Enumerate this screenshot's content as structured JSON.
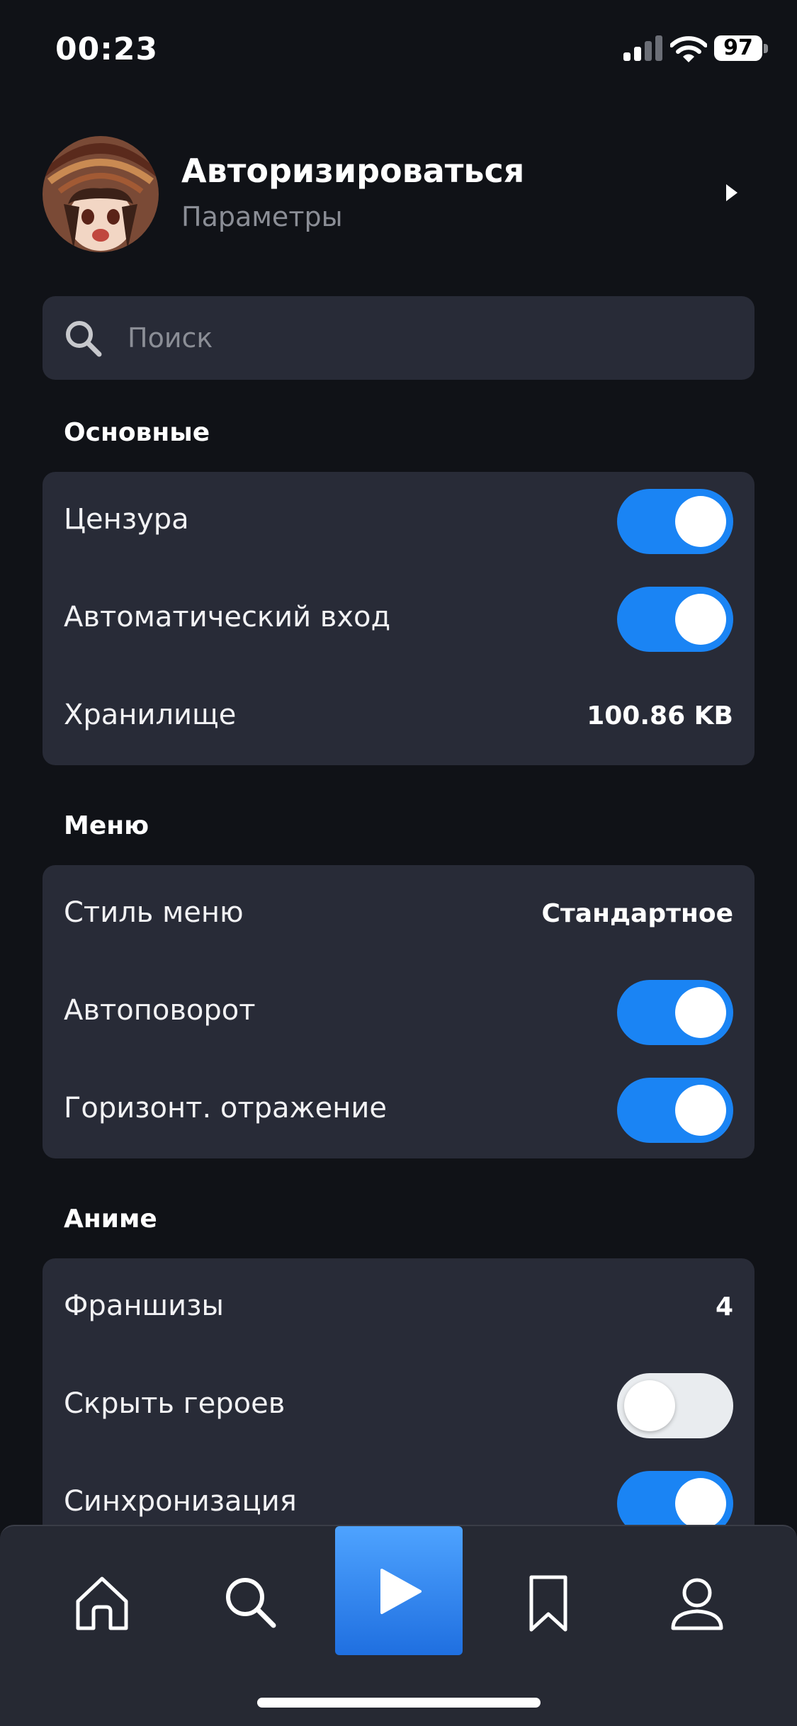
{
  "status_bar": {
    "time": "00:23",
    "battery": "97",
    "icons": [
      "signal-icon",
      "wifi-icon",
      "battery-icon"
    ]
  },
  "profile": {
    "title": "Авторизироваться",
    "subtitle": "Параметры",
    "arrow_icon": "chevron-right-icon"
  },
  "search": {
    "placeholder": "Поиск",
    "icon": "search-icon"
  },
  "sections": {
    "basic": {
      "title": "Основные",
      "censorship": {
        "label": "Цензура",
        "enabled": true
      },
      "auto_login": {
        "label": "Автоматический вход",
        "enabled": true
      },
      "storage": {
        "label": "Хранилище",
        "value": "100.86 KB"
      }
    },
    "menu": {
      "title": "Меню",
      "menu_style": {
        "label": "Стиль меню",
        "value": "Стандартное"
      },
      "auto_rotate": {
        "label": "Автоповорот",
        "enabled": true
      },
      "horizontal_flip": {
        "label": "Горизонт. отражение",
        "enabled": true
      }
    },
    "anime": {
      "title": "Аниме",
      "franchises": {
        "label": "Франшизы",
        "value": "4"
      },
      "hide_heroes": {
        "label": "Скрыть героев",
        "enabled": false
      },
      "sync": {
        "label": "Синхронизация",
        "enabled": true
      }
    }
  },
  "tab_bar": {
    "items": [
      "home-icon",
      "search-icon",
      "play-icon",
      "bookmark-icon",
      "profile-icon"
    ],
    "active": "play-icon"
  },
  "colors": {
    "background": "#101217",
    "card": "#282b37",
    "accent": "#1a84f4",
    "secondary_text": "#8b8e96"
  }
}
